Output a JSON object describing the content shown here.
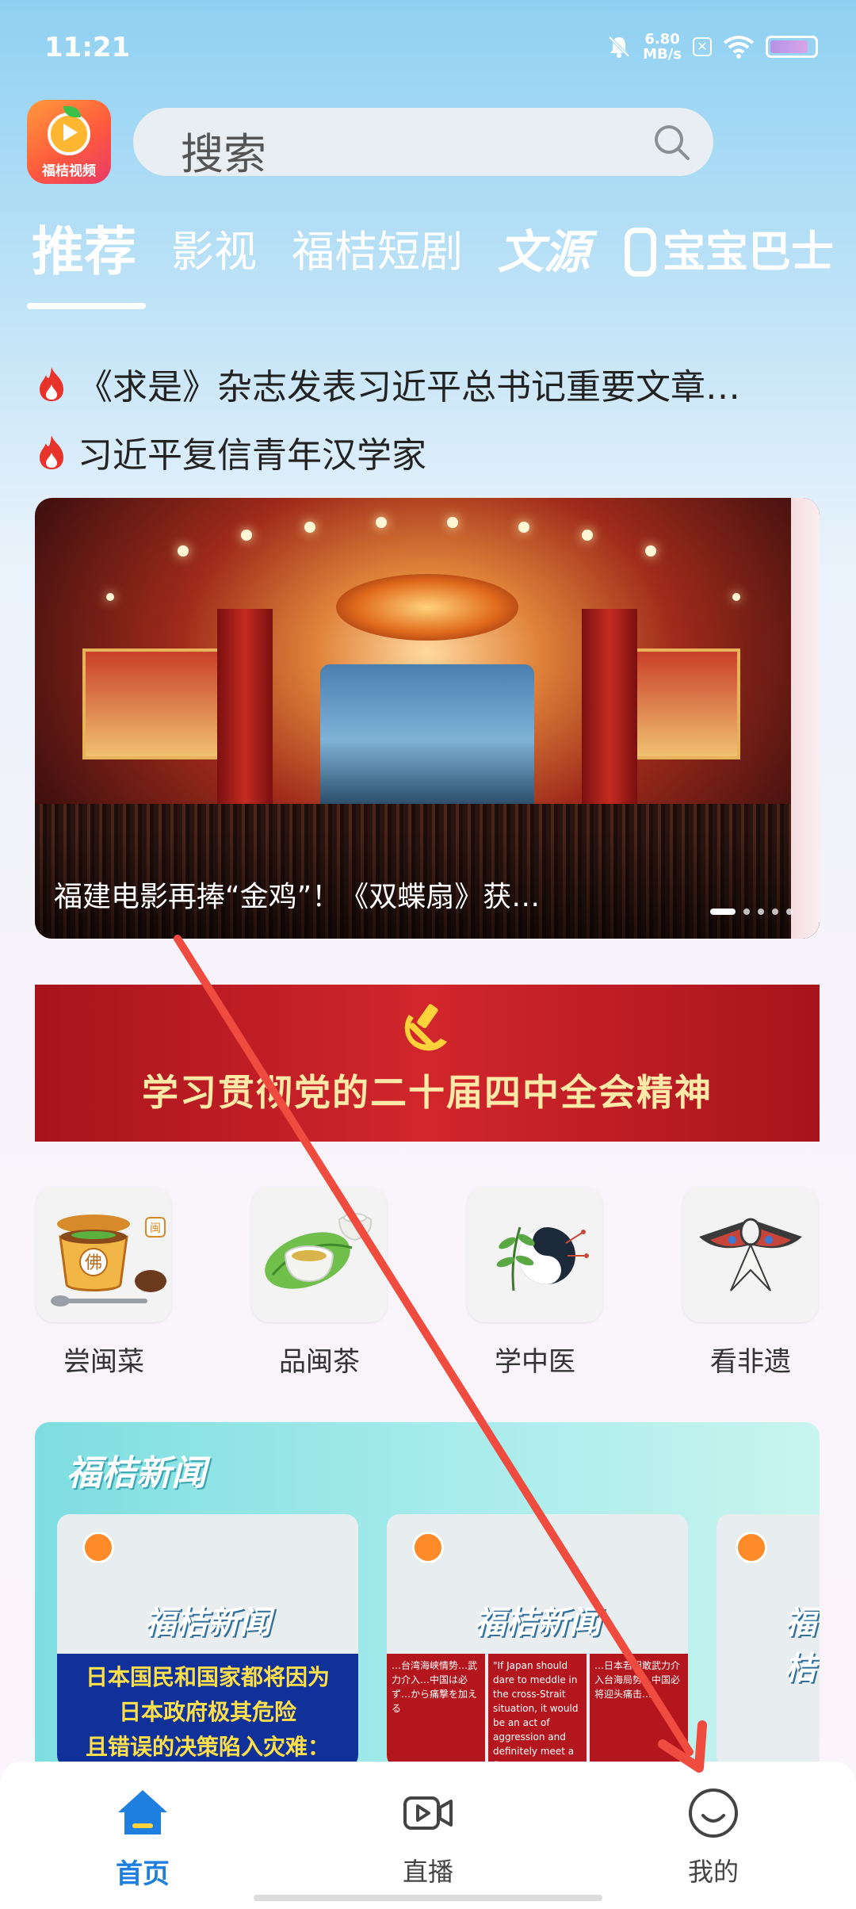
{
  "status_bar": {
    "time": "11:21",
    "net_speed_value": "6.80",
    "net_speed_unit": "MB/s"
  },
  "header": {
    "app_name": "福桔视频",
    "search_placeholder": "搜索"
  },
  "tabs": [
    {
      "label": "推荐",
      "active": true
    },
    {
      "label": "影视",
      "active": false
    },
    {
      "label": "福桔短剧",
      "active": false
    },
    {
      "label": "文源",
      "active": false
    },
    {
      "label": "宝宝巴士",
      "active": false
    }
  ],
  "headlines": [
    {
      "text": "《求是》杂志发表习近平总书记重要文章…"
    },
    {
      "text": "习近平复信青年汉学家"
    }
  ],
  "banner": {
    "caption": "福建电影再捧“金鸡”！《双蝶扇》获…",
    "slide_count": 5,
    "active_slide": 1
  },
  "party_banner": {
    "text": "学习贯彻党的二十届四中全会精神"
  },
  "entries": [
    {
      "label": "尝闽菜",
      "icon": "fo-tiao-qiang-dish-icon",
      "badge": "闽",
      "glyph": "佛"
    },
    {
      "label": "品闽茶",
      "icon": "tea-cup-icon"
    },
    {
      "label": "学中医",
      "icon": "yin-yang-herb-icon"
    },
    {
      "label": "看非遗",
      "icon": "swallow-kite-icon"
    }
  ],
  "news": {
    "section_title": "福桔新闻",
    "cards": [
      {
        "brand": "福桔新闻",
        "headline_lines": [
          "日本国民和国家都将因为",
          "日本政府极其危险",
          "且错误的决策陷入灾难："
        ]
      },
      {
        "brand": "福桔新闻",
        "columns": [
          "…台湾海峡情势…武力介入…中国は必ず…から痛撃を加える",
          "\"If Japan should dare to meddle in the cross-Strait situation, it would be an act of aggression and definitely meet a firm response from China.\"",
          "…日本若胆敢武力介入台海局势…中国必将迎头痛击…"
        ]
      },
      {
        "brand": "福桔"
      }
    ]
  },
  "bottom_nav": {
    "items": [
      {
        "label": "首页",
        "icon": "home-icon",
        "active": true
      },
      {
        "label": "直播",
        "icon": "live-video-icon",
        "active": false
      },
      {
        "label": "我的",
        "icon": "smiley-profile-icon",
        "active": false
      }
    ]
  },
  "colors": {
    "accent": "#1e7fe0",
    "party_red": "#c41e24",
    "party_gold": "#ffe9a8",
    "news_teal": "#7edde0",
    "gesture_arrow": "#ef4b3f"
  }
}
